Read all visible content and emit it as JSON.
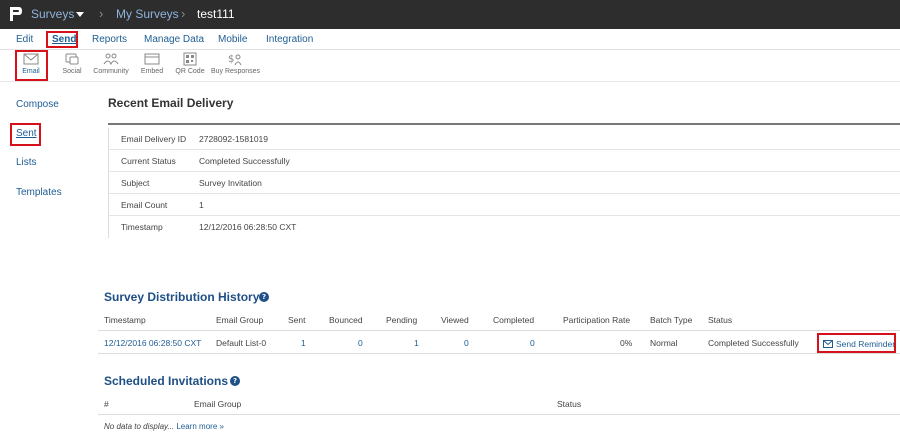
{
  "header": {
    "surveys_label": "Surveys",
    "breadcrumb_sep": "›",
    "mysurveys_label": "My Surveys",
    "current_label": "test111"
  },
  "menu": {
    "items": [
      "Edit",
      "Send",
      "Reports",
      "Manage Data",
      "Mobile",
      "Integration"
    ],
    "active": "Send"
  },
  "toolbar": {
    "items": [
      {
        "label": "Email",
        "icon": "envelope-icon"
      },
      {
        "label": "Social",
        "icon": "social-icon"
      },
      {
        "label": "Community",
        "icon": "community-icon"
      },
      {
        "label": "Embed",
        "icon": "embed-icon"
      },
      {
        "label": "QR Code",
        "icon": "qr-code-icon"
      },
      {
        "label": "Buy Responses",
        "icon": "buy-responses-icon"
      }
    ],
    "active": "Email"
  },
  "sidebar": {
    "items": [
      "Compose",
      "Sent",
      "Lists",
      "Templates"
    ],
    "active": "Sent"
  },
  "delivery": {
    "title": "Recent Email Delivery",
    "rows": [
      {
        "key": "Email Delivery ID",
        "value": "2728092-1581019"
      },
      {
        "key": "Current Status",
        "value": "Completed Successfully"
      },
      {
        "key": "Subject",
        "value": "Survey Invitation"
      },
      {
        "key": "Email Count",
        "value": "1"
      },
      {
        "key": "Timestamp",
        "value": "12/12/2016 06:28:50 CXT"
      }
    ]
  },
  "history": {
    "title": "Survey Distribution History",
    "help": "?",
    "columns": [
      "Timestamp",
      "Email Group",
      "Sent",
      "Bounced",
      "Pending",
      "Viewed",
      "Completed",
      "Participation Rate",
      "Batch Type",
      "Status"
    ],
    "row": {
      "timestamp": "12/12/2016 06:28:50 CXT",
      "email_group": "Default List-0",
      "sent": "1",
      "bounced": "0",
      "pending": "1",
      "viewed": "0",
      "completed": "0",
      "participation_rate": "0%",
      "batch_type": "Normal",
      "status": "Completed Successfully"
    },
    "reminder_label": "Send Reminder"
  },
  "scheduled": {
    "title": "Scheduled Invitations",
    "help": "?",
    "columns": [
      "#",
      "Email Group",
      "Status"
    ],
    "empty_text": "No data to display...",
    "learn_more": "Learn more »"
  },
  "colors": {
    "topbar": "#2d2d2d",
    "link": "#1e5d93",
    "heading": "#1e4f86",
    "highlight": "#d6111b"
  }
}
